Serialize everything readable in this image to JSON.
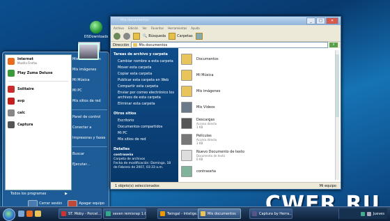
{
  "desktop": {
    "icon1_label": "DSDownloads",
    "watermark": "CWER.RU"
  },
  "start_menu": {
    "pinned": [
      {
        "title": "Internet",
        "sub": "Mozilla Firefox",
        "color": "#e86b1f"
      },
      {
        "title": "Play Zuma Deluxe",
        "sub": "",
        "color": "#3a9a3a"
      },
      {
        "title": "Solitaire",
        "sub": "",
        "color": "#cc2b2b"
      },
      {
        "title": "avp",
        "sub": "",
        "color": "#c41e1e"
      },
      {
        "title": "calc",
        "sub": "",
        "color": "#888888"
      },
      {
        "title": "Captura",
        "sub": "",
        "color": "#555555"
      }
    ],
    "all_programs": "Todos los programas",
    "right_items": [
      "Mis documentos",
      "Mis imágenes",
      "Mi Música",
      "Mi PC",
      "Mis sitios de red",
      "Panel de control",
      "Conectar a",
      "Impresoras y faxes",
      "Buscar",
      "Ejecutar..."
    ],
    "logoff": "Cerrar sesión",
    "shutdown": "Apagar equipo"
  },
  "explorer": {
    "title": "Mis documentos",
    "menu": [
      "Archivo",
      "Edición",
      "Ver",
      "Favoritos",
      "Herramientas",
      "Ayuda"
    ],
    "toolbar": {
      "search": "Búsqueda",
      "folders": "Carpetas"
    },
    "address_label": "Dirección",
    "address_value": "Mis documentos",
    "go_label": "Ir",
    "tasks_title": "Tareas de archivo y carpeta",
    "tasks": [
      "Cambiar nombre a esta carpeta",
      "Mover esta carpeta",
      "Copiar esta carpeta",
      "Publicar esta carpeta en Web",
      "Compartir esta carpeta",
      "Enviar por correo electrónico los archivos de esta carpeta",
      "Eliminar esta carpeta"
    ],
    "places_title": "Otros sitios",
    "places": [
      "Escritorio",
      "Documentos compartidos",
      "Mi PC",
      "Mis sitios de red"
    ],
    "details_title": "Detalles",
    "details_name": "contraseña",
    "details_type": "Carpeta de archivos",
    "details_date": "Fecha de modificación: Domingo, 18 de Febrero de 2007, 03:33 a.m.",
    "items": [
      {
        "name": "Documentos",
        "meta1": "",
        "meta2": "",
        "color": "#e8c45a"
      },
      {
        "name": "Mi Música",
        "meta1": "",
        "meta2": "",
        "color": "#e8c45a"
      },
      {
        "name": "Mis imágenes",
        "meta1": "",
        "meta2": "",
        "color": "#e8c45a"
      },
      {
        "name": "Mis Vídeos",
        "meta1": "",
        "meta2": "",
        "color": "#6a7a8a"
      },
      {
        "name": "Descargas",
        "meta1": "Acceso directo",
        "meta2": "3 KB",
        "color": "#555555"
      },
      {
        "name": "Películas",
        "meta1": "Acceso directo",
        "meta2": "3 KB",
        "color": "#777777"
      },
      {
        "name": "Nuevo Documento de texto",
        "meta1": "Documento de texto",
        "meta2": "0 KB",
        "color": "#dddddd"
      },
      {
        "name": "contraseña",
        "meta1": "",
        "meta2": "",
        "color": "#7fb39a"
      }
    ],
    "status_left": "1 objeto(s) seleccionados",
    "status_right": "Mi equipo"
  },
  "taskbar": {
    "buttons": [
      {
        "label": "ST. Moby - Porcel...",
        "color": "#c33"
      },
      {
        "label": "seven remixrap 1.8...",
        "color": "#3a8"
      },
      {
        "label": "Twingal - Intelige...",
        "color": "#e90"
      },
      {
        "label": "Mis documentos",
        "color": "#e8c45a"
      },
      {
        "label": "Captura by Herra...",
        "color": "#558"
      }
    ],
    "clock": "Jueves"
  }
}
